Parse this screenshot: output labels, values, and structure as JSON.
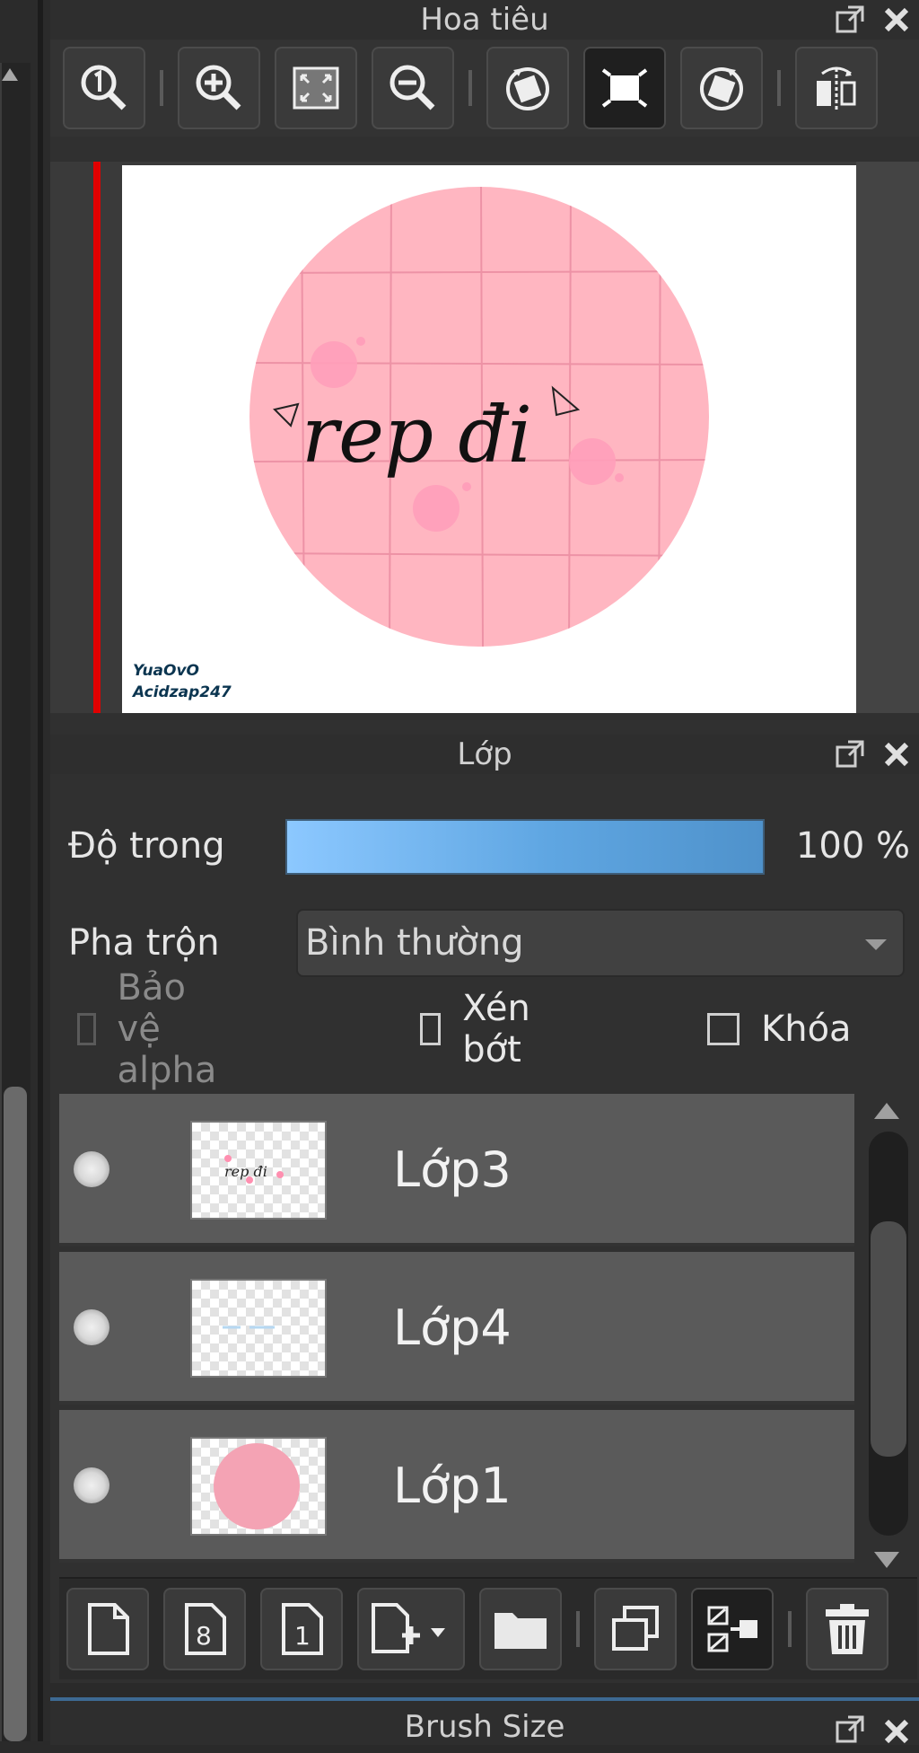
{
  "navigator": {
    "title": "Hoa tiêu",
    "canvas": {
      "art_text": "rep đi",
      "watermark_line1": "YuaOvO",
      "watermark_line2": "Acidzap247"
    },
    "toolbar_icons": [
      "zoom-actual-icon",
      "zoom-in-icon",
      "fit-screen-icon",
      "zoom-out-icon",
      "rotate-left-icon",
      "fit-rotate-icon",
      "rotate-right-icon",
      "flip-horizontal-icon"
    ]
  },
  "layers": {
    "title": "Lớp",
    "opacity_label": "Độ trong",
    "opacity_value": "100 %",
    "opacity_fraction": 1.0,
    "blend_label": "Pha trộn",
    "blend_value": "Bình thường",
    "checkbox_alpha": "Bảo vệ alpha",
    "checkbox_clip": "Xén bớt",
    "checkbox_lock": "Khóa",
    "items": [
      {
        "name": "Lớp3"
      },
      {
        "name": "Lớp4"
      },
      {
        "name": "Lớp1"
      }
    ]
  },
  "brush": {
    "title": "Brush Size"
  },
  "colors": {
    "accent": "#3d6a93",
    "opacity_fill_start": "#8cc8ff",
    "opacity_fill_end": "#4f92cb",
    "pink": "#ffb6c1",
    "red_marker": "#e00000"
  }
}
